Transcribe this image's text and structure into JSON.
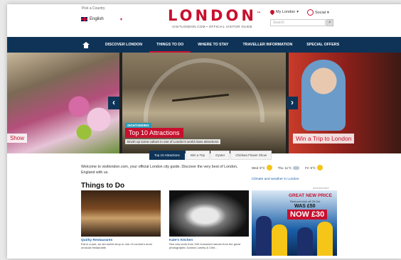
{
  "header": {
    "lang_label": "Pick a Country",
    "lang_value": "English",
    "logo": "LONDON",
    "tagline": "VISITLONDON.COM • OFFICIAL VISITOR GUIDE",
    "my_london": "My London",
    "social": "Social",
    "search_placeholder": "Search"
  },
  "nav": {
    "items": [
      "DISCOVER LONDON",
      "THINGS TO DO",
      "WHERE TO STAY",
      "TRAVELLER INFORMATION",
      "SPECIAL OFFERS"
    ],
    "active": "THINGS TO DO"
  },
  "carousel": {
    "slide1_caption": "Show",
    "slide2_tag": "SIGHTSEEING",
    "slide2_caption": "Top 10 Attractions",
    "slide2_sub": "Brush up some culture in one of London's world class attractions",
    "slide3_caption": "Win a Trip to London"
  },
  "tabs": [
    "Top 10 Attractions",
    "Win a Trip",
    "Oyster",
    "Chelsea Flower Show"
  ],
  "welcome": "Welcome to visitlondon.com, your official London city guide. Discover the very best of London, England with us.",
  "weather": {
    "days": [
      {
        "day": "Wed",
        "temp": "8°C",
        "icon": "sun"
      },
      {
        "day": "Thu",
        "temp": "11°C",
        "icon": "cloud-sun"
      },
      {
        "day": "Fri",
        "temp": "9°C",
        "icon": "cloud-sun"
      }
    ],
    "link": "Climate and weather in London"
  },
  "things_title": "Things to Do",
  "cards": [
    {
      "title": "Quirky Restaurants",
      "desc": "Eat in a pub, an old sweet shop or one of London's most unusual restaurants"
    },
    {
      "title": "Kate's Kitchen",
      "desc": "See new work from 150 renowned names from the great photographic Joanna Lumley & Clint..."
    }
  ],
  "ad": {
    "label": "Advertisement",
    "headline": "GREAT NEW PRICE",
    "sub": "Reduced kick off 25 Oct",
    "was": "WAS £50",
    "now": "NOW £30"
  }
}
